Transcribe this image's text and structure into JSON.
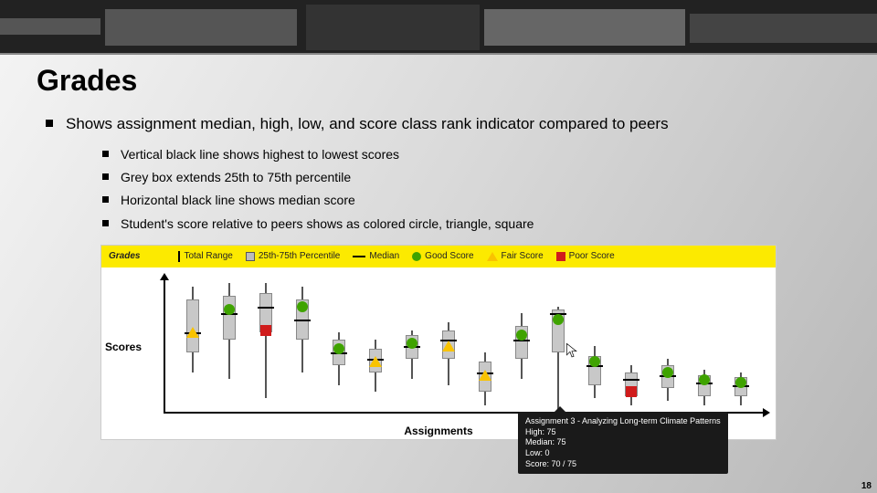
{
  "slide": {
    "title": "Grades",
    "bullet_main": "Shows assignment median, high, low, and score class rank indicator compared to peers",
    "sub_bullets": [
      "Vertical black line shows highest to lowest scores",
      "Grey box extends 25th to 75th  percentile",
      "Horizontal black line shows median score",
      "Student's score relative to peers shows as colored circle, triangle, square"
    ],
    "page_number": "18"
  },
  "chart": {
    "header_text": "Grades",
    "y_axis_label": "Scores",
    "x_axis_label": "Assignments",
    "legend": {
      "total_range": "Total Range",
      "p25_75": "25th-75th Percentile",
      "median": "Median",
      "good": "Good Score",
      "fair": "Fair Score",
      "poor": "Poor Score"
    },
    "tooltip": {
      "title": "Assignment 3 - Analyzing Long-term Climate Patterns",
      "high": "High: 75",
      "median": "Median: 75",
      "low": "Low: 0",
      "score": "Score: 70 / 75"
    }
  },
  "chart_data": {
    "type": "box",
    "ylabel": "Scores",
    "xlabel": "Assignments",
    "ylim": [
      0,
      100
    ],
    "series": [
      {
        "i": 0,
        "low": 30,
        "q1": 45,
        "median": 60,
        "q3": 85,
        "high": 95,
        "marker": "fair",
        "score": 60
      },
      {
        "i": 1,
        "low": 25,
        "q1": 55,
        "median": 75,
        "q3": 88,
        "high": 98,
        "marker": "good",
        "score": 78
      },
      {
        "i": 2,
        "low": 10,
        "q1": 60,
        "median": 80,
        "q3": 90,
        "high": 98,
        "marker": "poor",
        "score": 62
      },
      {
        "i": 3,
        "low": 30,
        "q1": 55,
        "median": 70,
        "q3": 85,
        "high": 95,
        "marker": "good",
        "score": 80
      },
      {
        "i": 4,
        "low": 20,
        "q1": 35,
        "median": 45,
        "q3": 55,
        "high": 60,
        "marker": "good",
        "score": 48
      },
      {
        "i": 5,
        "low": 15,
        "q1": 30,
        "median": 40,
        "q3": 48,
        "high": 55,
        "marker": "fair",
        "score": 38
      },
      {
        "i": 6,
        "low": 25,
        "q1": 40,
        "median": 50,
        "q3": 58,
        "high": 62,
        "marker": "good",
        "score": 52
      },
      {
        "i": 7,
        "low": 20,
        "q1": 40,
        "median": 55,
        "q3": 62,
        "high": 68,
        "marker": "fair",
        "score": 50
      },
      {
        "i": 8,
        "low": 5,
        "q1": 15,
        "median": 30,
        "q3": 38,
        "high": 45,
        "marker": "fair",
        "score": 28
      },
      {
        "i": 9,
        "low": 25,
        "q1": 40,
        "median": 55,
        "q3": 65,
        "high": 75,
        "marker": "good",
        "score": 58
      },
      {
        "i": 10,
        "low": 0,
        "q1": 45,
        "median": 75,
        "q3": 78,
        "high": 80,
        "marker": "good",
        "score": 70
      },
      {
        "i": 11,
        "low": 10,
        "q1": 20,
        "median": 35,
        "q3": 42,
        "high": 50,
        "marker": "good",
        "score": 38
      },
      {
        "i": 12,
        "low": 5,
        "q1": 12,
        "median": 25,
        "q3": 30,
        "high": 35,
        "marker": "poor",
        "score": 15
      },
      {
        "i": 13,
        "low": 8,
        "q1": 18,
        "median": 28,
        "q3": 35,
        "high": 40,
        "marker": "good",
        "score": 30
      },
      {
        "i": 14,
        "low": 5,
        "q1": 12,
        "median": 22,
        "q3": 28,
        "high": 32,
        "marker": "good",
        "score": 24
      },
      {
        "i": 15,
        "low": 5,
        "q1": 12,
        "median": 20,
        "q3": 26,
        "high": 30,
        "marker": "good",
        "score": 22
      }
    ],
    "tooltip_on_index": 10
  }
}
